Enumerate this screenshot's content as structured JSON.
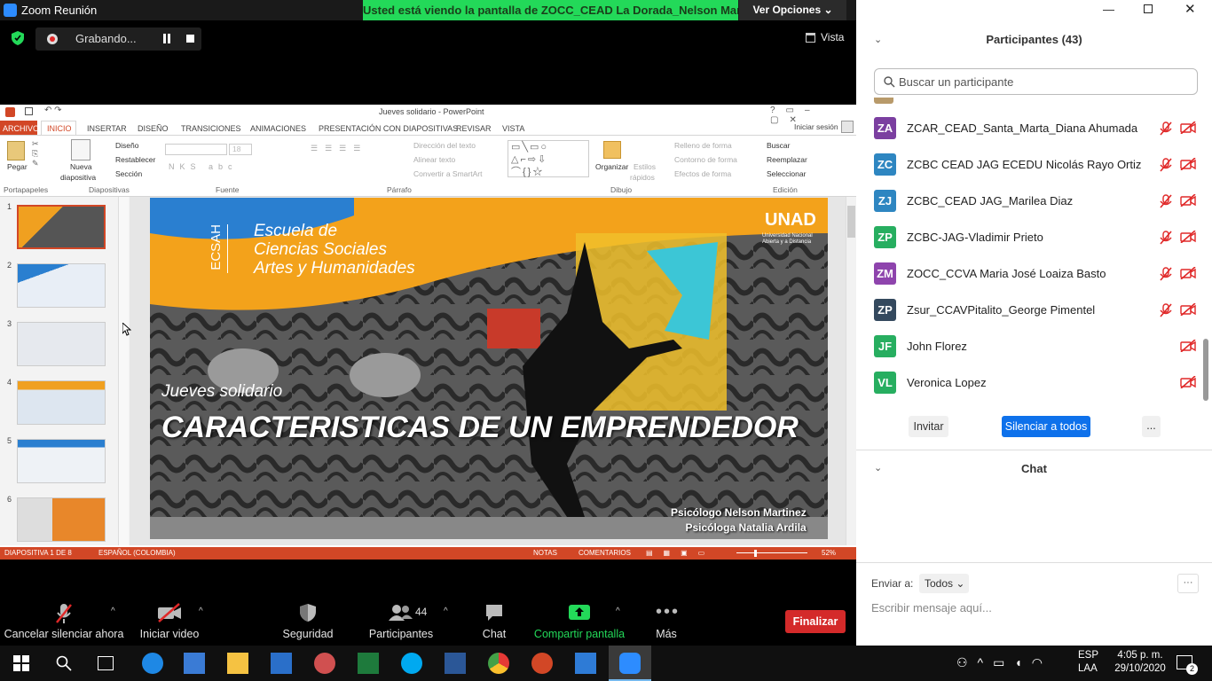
{
  "window": {
    "title": "Zoom Reunión",
    "share_banner": "Usted está viendo la pantalla de ZOCC_CEAD La Dorada_Nelson Mar...",
    "view_options": "Ver Opciones",
    "recording": "Grabando...",
    "view_label": "Vista"
  },
  "ppt": {
    "title": "Jueves solidario - PowerPoint",
    "signin": "Iniciar sesión",
    "tabs": [
      "ARCHIVO",
      "INICIO",
      "INSERTAR",
      "DISEÑO",
      "TRANSICIONES",
      "ANIMACIONES",
      "PRESENTACIÓN CON DIAPOSITIVAS",
      "REVISAR",
      "VISTA"
    ],
    "groups": [
      "Portapapeles",
      "Diapositivas",
      "Fuente",
      "Párrafo",
      "Dibujo",
      "Edición"
    ],
    "ribbon": {
      "paste": "Pegar",
      "new_slide": "Nueva",
      "new_slide2": "diapositiva",
      "layout": "Diseño",
      "reset": "Restablecer",
      "section": "Sección",
      "font_size": "18",
      "text_dir": "Dirección del texto",
      "align_text": "Alinear texto",
      "smartart": "Convertir a SmartArt",
      "arrange": "Organizar",
      "styles": "Estilos",
      "styles2": "rápidos",
      "fill": "Relleno de forma",
      "outline": "Contorno de forma",
      "effects": "Efectos de forma",
      "find": "Buscar",
      "replace": "Reemplazar",
      "select": "Seleccionar"
    },
    "thumbs": [
      "1",
      "2",
      "3",
      "4",
      "5",
      "6"
    ],
    "slide": {
      "school1": "Escuela de",
      "school2": "Ciencias Sociales",
      "school3": "Artes y Humanidades",
      "vertical": "ECSAH",
      "logo": "UNAD",
      "logo_sub1": "Universidad Nacional",
      "logo_sub2": "Abierta y a Distancia",
      "subtitle": "Jueves solidario",
      "title": "CARACTERISTICAS DE UN EMPRENDEDOR",
      "author1": "Psicólogo Nelson Martinez",
      "author2": "Psicóloga Natalia Ardila"
    },
    "status": {
      "slide": "DIAPOSITIVA 1 DE 8",
      "lang": "ESPAÑOL (COLOMBIA)",
      "notes": "NOTAS",
      "comments": "COMENTARIOS",
      "zoom": "52%",
      "zoom_fraction": 0.52
    }
  },
  "controls": {
    "mute": "Cancelar silenciar ahora",
    "video": "Iniciar video",
    "security": "Seguridad",
    "participants": "Participantes",
    "participants_count": "44",
    "chat": "Chat",
    "share": "Compartir pantalla",
    "more": "Más",
    "end": "Finalizar"
  },
  "panel": {
    "header": "Participantes (43)",
    "search_placeholder": "Buscar un participante",
    "participants": [
      {
        "initials": "ZA",
        "name": "ZCAR_CEAD_Santa_Marta_Diana Ahumada",
        "color": "#7b3fa0",
        "muted": true
      },
      {
        "initials": "ZC",
        "name": "ZCBC CEAD JAG ECEDU Nicolás Rayo Ortiz",
        "color": "#2e86c1",
        "muted": true
      },
      {
        "initials": "ZJ",
        "name": "ZCBC_CEAD JAG_Marilea Diaz",
        "color": "#2e86c1",
        "muted": true
      },
      {
        "initials": "ZP",
        "name": "ZCBC-JAG-Vladimir Prieto",
        "color": "#27ae60",
        "muted": true
      },
      {
        "initials": "ZM",
        "name": "ZOCC_CCVA Maria José Loaiza Basto",
        "color": "#8e44ad",
        "muted": true
      },
      {
        "initials": "ZP",
        "name": "Zsur_CCAVPitalito_George Pimentel",
        "color": "#34495e",
        "muted": true
      },
      {
        "initials": "JF",
        "name": "John Florez",
        "color": "#27ae60",
        "muted": false
      },
      {
        "initials": "VL",
        "name": "Veronica Lopez",
        "color": "#27ae60",
        "muted": false
      }
    ],
    "invite": "Invitar",
    "mute_all": "Silenciar a todos",
    "more": "...",
    "chat_header": "Chat",
    "send_to": "Enviar a:",
    "send_to_value": "Todos",
    "message_placeholder": "Escribir mensaje aquí..."
  },
  "taskbar": {
    "lang1": "ESP",
    "lang2": "LAA",
    "time": "4:05 p. m.",
    "date": "29/10/2020",
    "notif": "2"
  }
}
